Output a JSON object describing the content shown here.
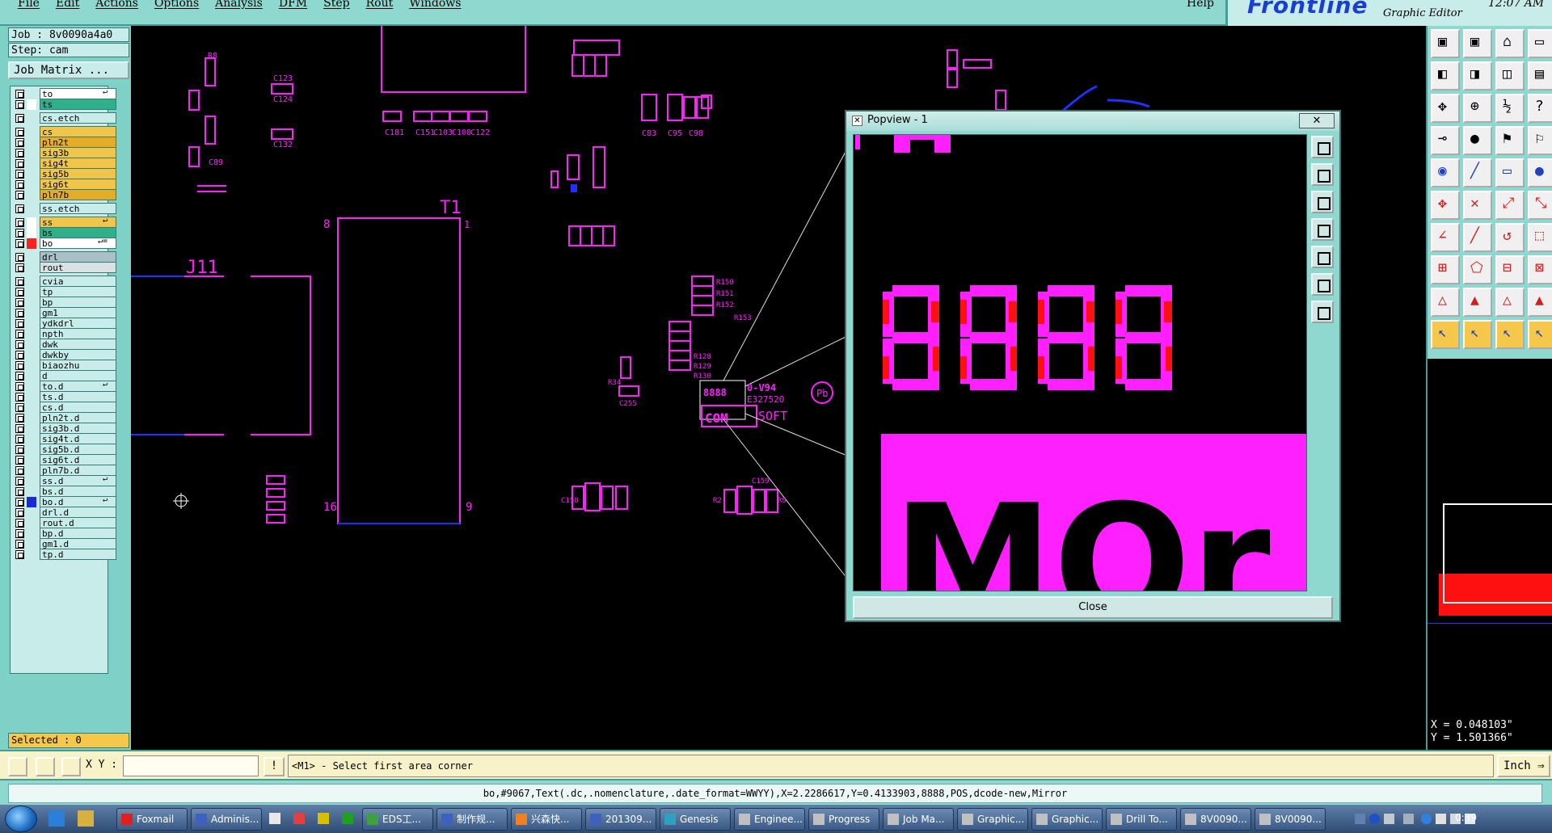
{
  "menubar": {
    "items": [
      "File",
      "Edit",
      "Actions",
      "Options",
      "Analysis",
      "DFM",
      "Step",
      "Rout",
      "Windows"
    ],
    "help": "Help"
  },
  "brand": {
    "logo": "Frontline",
    "subtitle": "Graphic Editor",
    "clock": "12:07 AM"
  },
  "job": {
    "job_label": "Job : 8v0090a4a0",
    "step_label": "Step: cam",
    "matrix_button": "Job Matrix ..."
  },
  "layers": [
    {
      "name": "to",
      "color": "#ffffff",
      "mark": "↵"
    },
    {
      "name": "ts",
      "color": "#2fb08a",
      "mark": ""
    },
    {
      "name": "cs.etch",
      "color": "#c8ecea",
      "mark": ""
    },
    {
      "name": "cs",
      "color": "#f0c64a",
      "mark": ""
    },
    {
      "name": "pln2t",
      "color": "#e3ad2a",
      "mark": ""
    },
    {
      "name": "sig3b",
      "color": "#f0c64a",
      "mark": ""
    },
    {
      "name": "sig4t",
      "color": "#f0c64a",
      "mark": ""
    },
    {
      "name": "sig5b",
      "color": "#f0c64a",
      "mark": ""
    },
    {
      "name": "sig6t",
      "color": "#f0c64a",
      "mark": ""
    },
    {
      "name": "pln7b",
      "color": "#e3ad2a",
      "mark": ""
    },
    {
      "name": "ss.etch",
      "color": "#c8ecea",
      "mark": ""
    },
    {
      "name": "ss",
      "color": "#f0c64a",
      "mark": "↵"
    },
    {
      "name": "bs",
      "color": "#2fb08a",
      "mark": ""
    },
    {
      "name": "bo",
      "color": "#ffffff",
      "mark": "↵="
    },
    {
      "name": "drl",
      "color": "#a8c0c6",
      "mark": ""
    },
    {
      "name": "rout",
      "color": "#d8e2e4",
      "mark": ""
    },
    {
      "name": "cvia",
      "color": "#c8ecea",
      "mark": ""
    },
    {
      "name": "tp",
      "color": "#c8ecea",
      "mark": ""
    },
    {
      "name": "bp",
      "color": "#c8ecea",
      "mark": ""
    },
    {
      "name": "gm1",
      "color": "#c8ecea",
      "mark": ""
    },
    {
      "name": "ydkdrl",
      "color": "#c8ecea",
      "mark": ""
    },
    {
      "name": "npth",
      "color": "#c8ecea",
      "mark": ""
    },
    {
      "name": "dwk",
      "color": "#c8ecea",
      "mark": ""
    },
    {
      "name": "dwkby",
      "color": "#c8ecea",
      "mark": ""
    },
    {
      "name": "biaozhu",
      "color": "#c8ecea",
      "mark": ""
    },
    {
      "name": "d",
      "color": "#c8ecea",
      "mark": ""
    },
    {
      "name": "to.d",
      "color": "#c8ecea",
      "mark": "↵"
    },
    {
      "name": "ts.d",
      "color": "#c8ecea",
      "mark": ""
    },
    {
      "name": "cs.d",
      "color": "#c8ecea",
      "mark": ""
    },
    {
      "name": "pln2t.d",
      "color": "#c8ecea",
      "mark": ""
    },
    {
      "name": "sig3b.d",
      "color": "#c8ecea",
      "mark": ""
    },
    {
      "name": "sig4t.d",
      "color": "#c8ecea",
      "mark": ""
    },
    {
      "name": "sig5b.d",
      "color": "#c8ecea",
      "mark": ""
    },
    {
      "name": "sig6t.d",
      "color": "#c8ecea",
      "mark": ""
    },
    {
      "name": "pln7b.d",
      "color": "#c8ecea",
      "mark": ""
    },
    {
      "name": "ss.d",
      "color": "#c8ecea",
      "mark": "↵"
    },
    {
      "name": "bs.d",
      "color": "#c8ecea",
      "mark": ""
    },
    {
      "name": "bo.d",
      "color": "#c8ecea",
      "mark": "↵"
    },
    {
      "name": "drl.d",
      "color": "#c8ecea",
      "mark": ""
    },
    {
      "name": "rout.d",
      "color": "#c8ecea",
      "mark": ""
    },
    {
      "name": "bp.d",
      "color": "#c8ecea",
      "mark": ""
    },
    {
      "name": "gm1.d",
      "color": "#c8ecea",
      "mark": ""
    },
    {
      "name": "tp.d",
      "color": "#c8ecea",
      "mark": ""
    }
  ],
  "layer_swatches": {
    "ts": "#ffffff",
    "ss": "#ffffff",
    "bs": "#ffffff",
    "bo": "#ff2020",
    "bo.d": "#1a2ad8"
  },
  "selected": "Selected : 0",
  "canvas": {
    "labels": {
      "j11": "J11",
      "t1": "T1",
      "t_pin1": "1",
      "t_pin8": "8",
      "t_pin16": "16",
      "t_pin9": "9",
      "r8": "R8",
      "c123": "C123",
      "c124": "C124",
      "c132": "C132",
      "c89": "C89",
      "c122": "C122",
      "r128": "R128",
      "r129": "R129",
      "r130": "R130",
      "c181": "C181",
      "c151": "C151",
      "c103": "C103",
      "c108": "C108",
      "r150": "R150",
      "r151": "R151",
      "r152": "R152",
      "r153": "R153",
      "r2": "R2",
      "r9": "R9",
      "c83": "C83",
      "c95": "C95",
      "c98": "C98",
      "c158": "C158",
      "c159": "C159",
      "c255": "C255",
      "r34": "R34",
      "date_code": "8888",
      "pos": "0-V94",
      "rohs": "Pb",
      "ul": "E327520",
      "company": "SOFT",
      "com": "COM"
    },
    "popview_digits": "8888",
    "popview_text": "MOr"
  },
  "popview": {
    "title": "Popview - 1",
    "close_x": "✕",
    "close_button": "Close"
  },
  "colors": {
    "layer_magenta": "#ff20ff",
    "highlight_red": "#ff1010",
    "trace_blue": "#2030ff",
    "ui_teal": "#8fd8d0",
    "brand_blue": "#1a3fd0"
  },
  "coords": {
    "x": "X = 0.048103\"",
    "y": "Y = 1.501366\""
  },
  "cmdbar": {
    "xy_label": "X Y :",
    "xy_value": "",
    "info": "!",
    "prompt": "<M1> - Select first area corner",
    "units": "Inch ⇒"
  },
  "statusbar": {
    "text": "bo,#9067,Text(.dc,.nomenclature,.date_format=WWYY),X=2.2286617,Y=0.4133903,8888,POS,dcode-new,Mirror"
  },
  "taskbar": {
    "tasks": [
      {
        "label": "Foxmail",
        "icon": "#e02020"
      },
      {
        "label": "Adminis...",
        "icon": "#4060c0"
      },
      {
        "label": "",
        "icon": "#e8e8e8"
      },
      {
        "label": "",
        "icon": "#e04040"
      },
      {
        "label": "",
        "icon": "#d8c000"
      },
      {
        "label": "",
        "icon": "#20a020"
      },
      {
        "label": "EDS工...",
        "icon": "#40a040"
      },
      {
        "label": "制作规...",
        "icon": "#4060c0"
      },
      {
        "label": "兴森快...",
        "icon": "#f08020"
      },
      {
        "label": "201309...",
        "icon": "#4060c0"
      },
      {
        "label": "Genesis",
        "icon": "#30a0c0"
      },
      {
        "label": "Enginee...",
        "icon": "#c0c0c0"
      },
      {
        "label": "Progress",
        "icon": "#c0c0c0"
      },
      {
        "label": "Job Ma...",
        "icon": "#c0c0c0"
      },
      {
        "label": "Graphic...",
        "icon": "#c0c0c0"
      },
      {
        "label": "Graphic...",
        "icon": "#c0c0c0"
      },
      {
        "label": "Drill To...",
        "icon": "#c0c0c0"
      },
      {
        "label": "8V0090...",
        "icon": "#c0c0c0"
      },
      {
        "label": "8V0090...",
        "icon": "#c0c0c0"
      }
    ],
    "clock": "0:39"
  }
}
